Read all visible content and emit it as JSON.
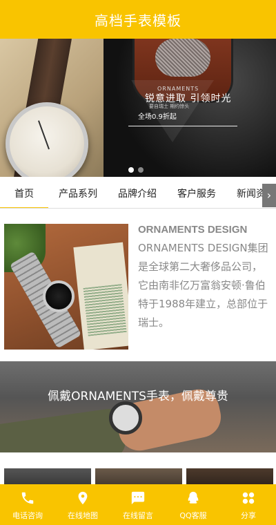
{
  "header": {
    "title": "高档手表模板"
  },
  "banner": {
    "brand_text": "ORNAMENTS",
    "slogan": "锐意进取 引领时光",
    "fine_print": "要自瑞士 期约惊头",
    "promo": "全场0.9折起",
    "slide_count": 2,
    "active_slide": 1
  },
  "nav": {
    "tabs": [
      "首页",
      "产品系列",
      "品牌介绍",
      "客户服务",
      "新闻资讯"
    ],
    "arrow": "›"
  },
  "about": {
    "heading": "ORNAMENTS DESIGN",
    "description": "ORNAMENTS DESIGN集团是全球第二大奢侈品公司，它由南非亿万富翁安顿·鲁伯特于1988年建立，总部位于瑞士。"
  },
  "promo_banner": {
    "text": "佩戴ORNAMENTS手表，佩戴尊贵"
  },
  "bottom_bar": {
    "items": [
      {
        "label": "电话咨询",
        "icon": "phone-icon"
      },
      {
        "label": "在线地图",
        "icon": "map-pin-icon"
      },
      {
        "label": "在线留言",
        "icon": "message-icon"
      },
      {
        "label": "QQ客服",
        "icon": "qq-icon"
      },
      {
        "label": "分享",
        "icon": "share-grid-icon"
      }
    ]
  },
  "colors": {
    "accent": "#f9c400",
    "text_gray": "#888888"
  }
}
